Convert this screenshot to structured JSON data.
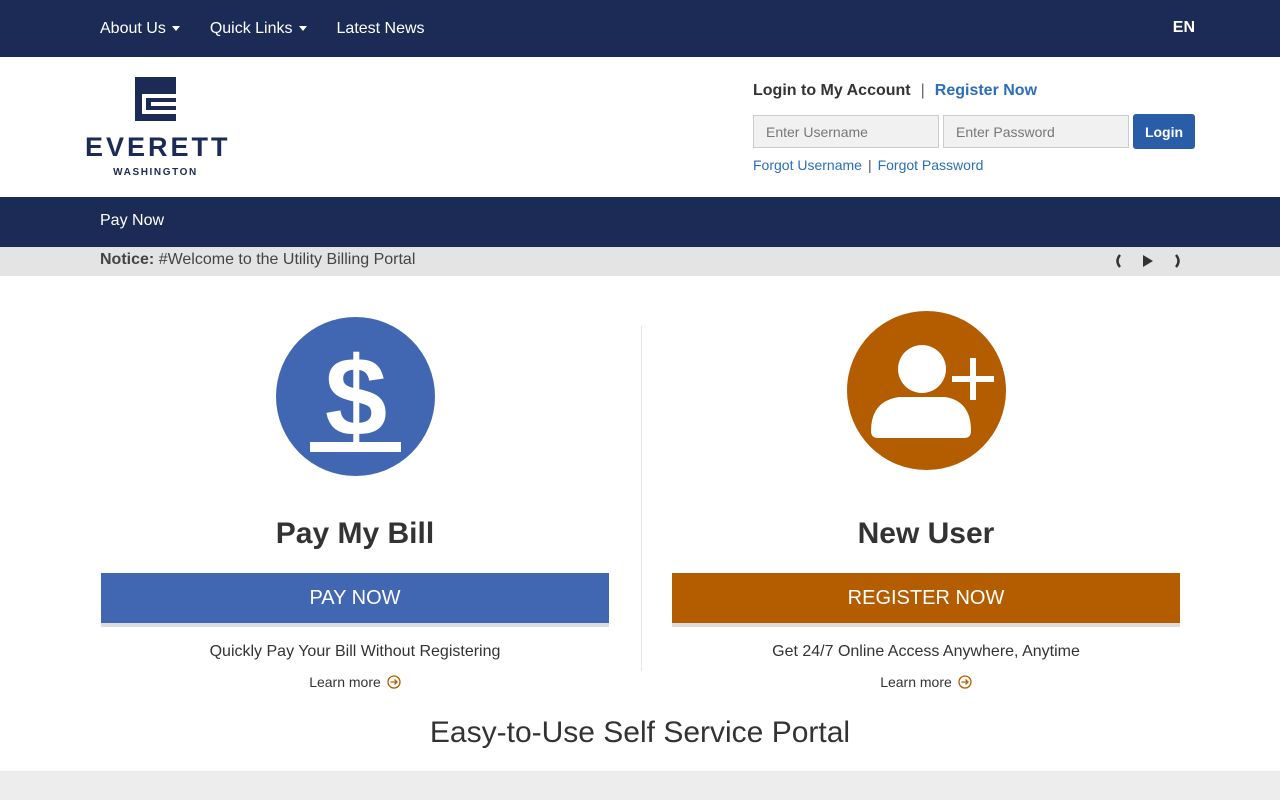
{
  "topnav": {
    "items": [
      {
        "label": "About Us",
        "dropdown": true
      },
      {
        "label": "Quick Links",
        "dropdown": true
      },
      {
        "label": "Latest News",
        "dropdown": false
      }
    ],
    "language": "EN"
  },
  "logo": {
    "name": "EVERETT",
    "sub": "WASHINGTON"
  },
  "login": {
    "title": "Login to My Account",
    "separator": "|",
    "register_link": "Register Now",
    "username_placeholder": "Enter Username",
    "password_placeholder": "Enter Password",
    "button": "Login",
    "forgot_username": "Forgot Username",
    "forgot_password": "Forgot Password"
  },
  "secondary_nav": {
    "item": "Pay Now"
  },
  "notice": {
    "label": "Notice:",
    "text": "#Welcome to the Utility Billing Portal"
  },
  "pay": {
    "title": "Pay My Bill",
    "button": "PAY NOW",
    "description": "Quickly Pay Your Bill Without Registering",
    "learn_more": "Learn more"
  },
  "newuser": {
    "title": "New User",
    "button": "REGISTER NOW",
    "description": "Get 24/7 Online Access Anywhere, Anytime",
    "learn_more": "Learn more"
  },
  "tagline": "Easy-to-Use Self Service Portal",
  "colors": {
    "navy": "#1b2b55",
    "blue": "#4267b2",
    "orange": "#b35c00",
    "link": "#2a6ebb"
  }
}
